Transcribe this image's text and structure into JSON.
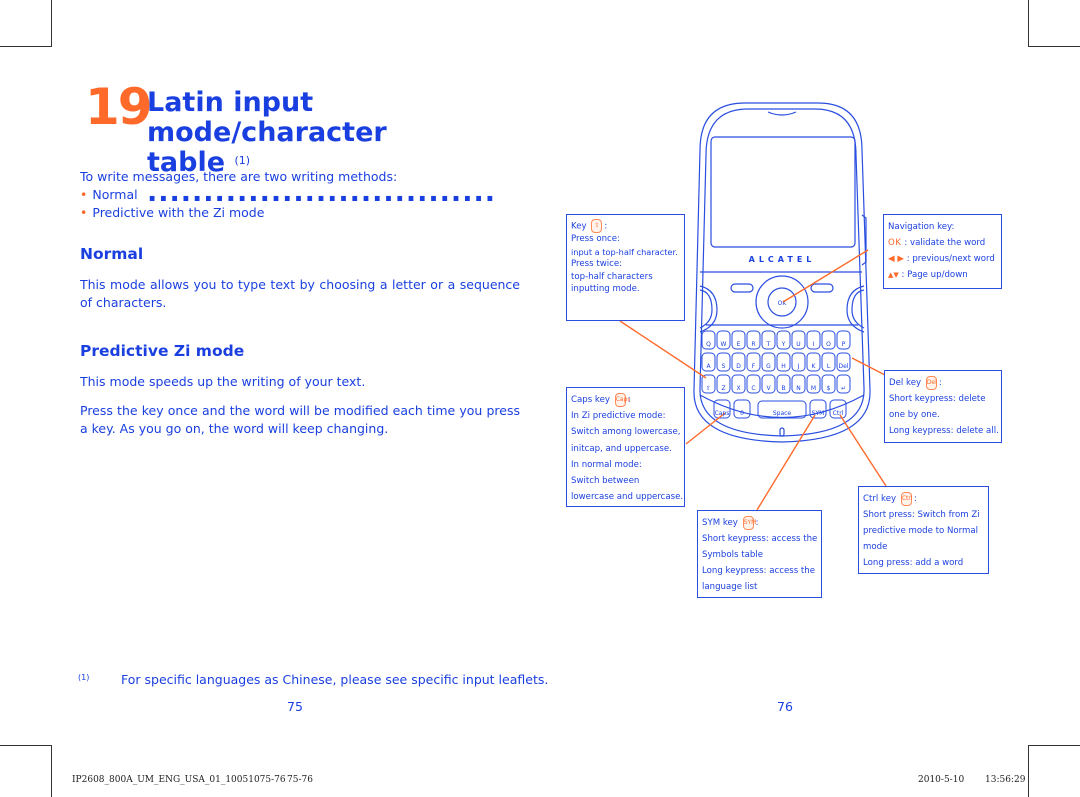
{
  "chapter": {
    "number": "19",
    "title_line1": "Latin input mode/character",
    "title_line2": "table",
    "title_footnote_ref": "(1)",
    "title_dots": "..............................."
  },
  "intro": {
    "text": "To write messages, there are two writing methods:",
    "bullets": [
      "Normal",
      "Predictive with the Zi mode"
    ],
    "bullet_glyph": "•"
  },
  "sections": [
    {
      "heading": "Normal",
      "paragraphs": [
        "This mode allows you to type text by choosing a letter or a sequence of characters."
      ]
    },
    {
      "heading": "Predictive Zi mode",
      "paragraphs": [
        "This mode speeds up the writing of your text.",
        "Press the key once and the word will be modified each time you press a key. As you go on, the word will keep changing."
      ]
    }
  ],
  "footnote": {
    "mark": "(1)",
    "text": "For specific languages as Chinese, please see specific input leaflets."
  },
  "page_numbers": {
    "left": "75",
    "right": "76"
  },
  "print_info": {
    "left": "IP2608_800A_UM_ENG_USA_01_10051075-76",
    "pages": "75-76",
    "date": "2010-5-10",
    "time": "13:56:29"
  },
  "phone": {
    "brand": "ALCATEL",
    "ok_label": "OK",
    "space_label": "Space",
    "caps_label": "Caps",
    "sym_label": "SYM",
    "ctrl_label": "Ctrl",
    "del_label": "Del",
    "keys_row1": [
      "Q",
      "W",
      "E",
      "R",
      "T",
      "Y",
      "U",
      "I",
      "O",
      "P"
    ],
    "keys_row2": [
      "A",
      "S",
      "D",
      "F",
      "G",
      "H",
      "J",
      "K",
      "L"
    ],
    "keys_row3": [
      "Z",
      "X",
      "C",
      "V",
      "B",
      "N",
      "M"
    ]
  },
  "callouts": {
    "shift_key": {
      "title": "Key",
      "lines": [
        "Press once:",
        "input a top-half character.",
        "Press twice:",
        "top-half characters",
        "inputting mode."
      ]
    },
    "navigation_key": {
      "title": "Navigation key:",
      "ok_label": "OK",
      "ok_text": ": validate the word",
      "lr_text": ": previous/next word",
      "ud_text": ": Page up/down"
    },
    "caps_key": {
      "title": "Caps key",
      "lines": [
        "In Zi predictive mode:",
        "Switch among lowercase,",
        "initcap, and uppercase.",
        "In normal mode:",
        "Switch between",
        "lowercase and uppercase."
      ]
    },
    "del_key": {
      "title": "Del key",
      "lines": [
        "Short keypress: delete",
        "one by one.",
        "Long keypress: delete all."
      ]
    },
    "ctrl_key": {
      "title": "Ctrl key",
      "lines": [
        "Short press: Switch from Zi",
        "predictive mode to Normal",
        "mode",
        "Long press: add a word"
      ]
    },
    "sym_key": {
      "title": "SYM key",
      "lines": [
        "Short keypress: access the",
        "Symbols table",
        "Long keypress: access the",
        "language list"
      ]
    }
  },
  "colors": {
    "text_blue": "#1a3fe0",
    "accent_orange": "#ff6a2b",
    "outline_blue": "#2a4ee0"
  }
}
